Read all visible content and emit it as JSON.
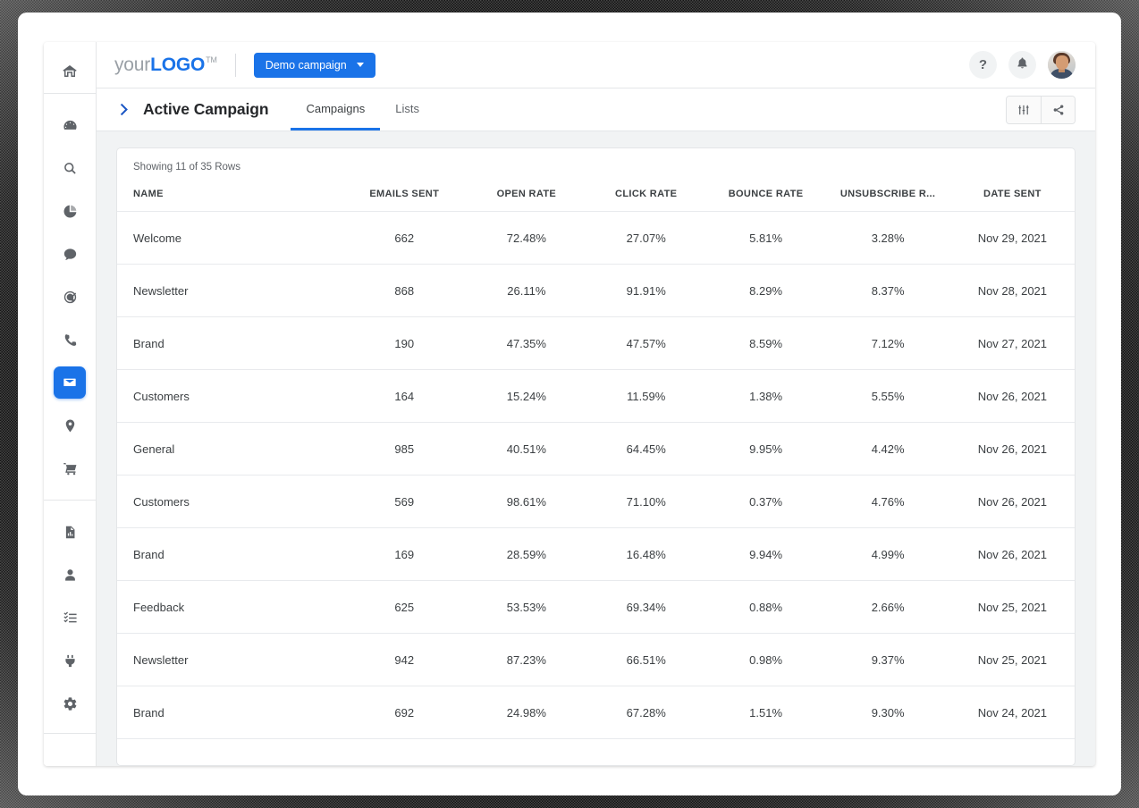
{
  "sidebar": {
    "groups": [
      {
        "items": [
          {
            "name": "home",
            "icon": "home-icon",
            "active": false
          }
        ]
      },
      {
        "items": [
          {
            "name": "dashboard",
            "icon": "speedometer-icon",
            "active": false
          },
          {
            "name": "search",
            "icon": "search-icon",
            "active": false
          },
          {
            "name": "analytics",
            "icon": "pie-chart-icon",
            "active": false
          },
          {
            "name": "messages",
            "icon": "chat-bubble-icon",
            "active": false
          },
          {
            "name": "support",
            "icon": "headset-icon",
            "active": false
          },
          {
            "name": "calls",
            "icon": "phone-icon",
            "active": false
          },
          {
            "name": "email",
            "icon": "envelope-icon",
            "active": true
          },
          {
            "name": "locations",
            "icon": "map-pin-icon",
            "active": false
          },
          {
            "name": "commerce",
            "icon": "shopping-cart-icon",
            "active": false
          }
        ]
      },
      {
        "items": [
          {
            "name": "reports",
            "icon": "document-chart-icon",
            "active": false
          },
          {
            "name": "contacts",
            "icon": "person-icon",
            "active": false
          },
          {
            "name": "tasks",
            "icon": "checklist-icon",
            "active": false
          },
          {
            "name": "integrations",
            "icon": "plug-icon",
            "active": false
          },
          {
            "name": "settings",
            "icon": "gear-icon",
            "active": false
          }
        ]
      }
    ]
  },
  "topbar": {
    "logo_your": "your",
    "logo_logo": "LOGO",
    "logo_tm": "TM",
    "campaign_button": "Demo campaign",
    "help_label": "?",
    "notifications_icon": "bell-icon",
    "avatar_icon": "user-avatar"
  },
  "tabbar": {
    "chevron_icon": "chevron-right-icon",
    "page_title": "Active Campaign",
    "tabs": [
      {
        "label": "Campaigns",
        "active": true
      },
      {
        "label": "Lists",
        "active": false
      }
    ],
    "columns_button_icon": "sliders-icon",
    "share_button_icon": "share-icon"
  },
  "table": {
    "showing": "Showing 11 of 35 Rows",
    "columns": [
      "NAME",
      "EMAILS SENT",
      "OPEN RATE",
      "CLICK RATE",
      "BOUNCE RATE",
      "UNSUBSCRIBE R...",
      "DATE SENT"
    ],
    "rows": [
      {
        "name": "Welcome",
        "emails_sent": "662",
        "open_rate": "72.48%",
        "click_rate": "27.07%",
        "bounce_rate": "5.81%",
        "unsubscribe_rate": "3.28%",
        "date_sent": "Nov 29, 2021"
      },
      {
        "name": "Newsletter",
        "emails_sent": "868",
        "open_rate": "26.11%",
        "click_rate": "91.91%",
        "bounce_rate": "8.29%",
        "unsubscribe_rate": "8.37%",
        "date_sent": "Nov 28, 2021"
      },
      {
        "name": "Brand",
        "emails_sent": "190",
        "open_rate": "47.35%",
        "click_rate": "47.57%",
        "bounce_rate": "8.59%",
        "unsubscribe_rate": "7.12%",
        "date_sent": "Nov 27, 2021"
      },
      {
        "name": "Customers",
        "emails_sent": "164",
        "open_rate": "15.24%",
        "click_rate": "11.59%",
        "bounce_rate": "1.38%",
        "unsubscribe_rate": "5.55%",
        "date_sent": "Nov 26, 2021"
      },
      {
        "name": "General",
        "emails_sent": "985",
        "open_rate": "40.51%",
        "click_rate": "64.45%",
        "bounce_rate": "9.95%",
        "unsubscribe_rate": "4.42%",
        "date_sent": "Nov 26, 2021"
      },
      {
        "name": "Customers",
        "emails_sent": "569",
        "open_rate": "98.61%",
        "click_rate": "71.10%",
        "bounce_rate": "0.37%",
        "unsubscribe_rate": "4.76%",
        "date_sent": "Nov 26, 2021"
      },
      {
        "name": "Brand",
        "emails_sent": "169",
        "open_rate": "28.59%",
        "click_rate": "16.48%",
        "bounce_rate": "9.94%",
        "unsubscribe_rate": "4.99%",
        "date_sent": "Nov 26, 2021"
      },
      {
        "name": "Feedback",
        "emails_sent": "625",
        "open_rate": "53.53%",
        "click_rate": "69.34%",
        "bounce_rate": "0.88%",
        "unsubscribe_rate": "2.66%",
        "date_sent": "Nov 25, 2021"
      },
      {
        "name": "Newsletter",
        "emails_sent": "942",
        "open_rate": "87.23%",
        "click_rate": "66.51%",
        "bounce_rate": "0.98%",
        "unsubscribe_rate": "9.37%",
        "date_sent": "Nov 25, 2021"
      },
      {
        "name": "Brand",
        "emails_sent": "692",
        "open_rate": "24.98%",
        "click_rate": "67.28%",
        "bounce_rate": "1.51%",
        "unsubscribe_rate": "9.30%",
        "date_sent": "Nov 24, 2021"
      }
    ]
  },
  "colors": {
    "accent_blue": "#1a73e8",
    "chevron_blue": "#1a56c4",
    "text_primary": "#3c4043",
    "text_muted": "#5f6368",
    "page_bg": "#f1f3f4",
    "border": "#e4e6e8"
  }
}
